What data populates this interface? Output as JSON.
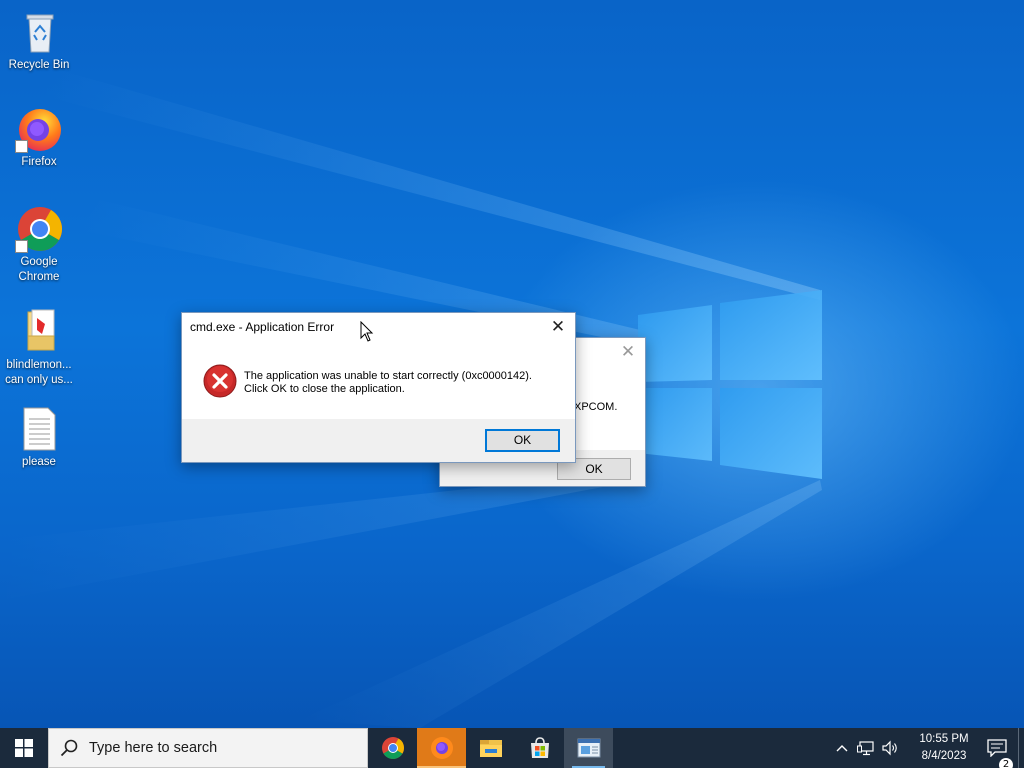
{
  "desktop": {
    "icons": [
      {
        "label": "Recycle Bin",
        "icon": "recycle-bin-icon"
      },
      {
        "label": "Firefox",
        "icon": "firefox-icon"
      },
      {
        "label": "Google Chrome",
        "icon": "chrome-icon"
      },
      {
        "label": "blindlemon... can only us...",
        "icon": "folder-icon"
      },
      {
        "label": "please",
        "icon": "text-file-icon"
      }
    ]
  },
  "dialog_back": {
    "message_fragment": "XPCOM.",
    "ok_label": "OK"
  },
  "dialog_front": {
    "title": "cmd.exe - Application Error",
    "message_line1": "The application was unable to start correctly (0xc0000142).",
    "message_line2": "Click OK to close the application.",
    "ok_label": "OK",
    "icon": "error-icon"
  },
  "taskbar": {
    "search_placeholder": "Type here to search",
    "apps": [
      "chrome",
      "firefox",
      "file-explorer",
      "microsoft-store",
      "application-window"
    ],
    "time": "10:55 PM",
    "date": "8/4/2023",
    "notification_count": "2"
  },
  "colors": {
    "wallpaper": "#0a66cb",
    "taskbar": "#1b2a3c",
    "accent": "#0078d7",
    "error_red": "#d32f2f"
  }
}
